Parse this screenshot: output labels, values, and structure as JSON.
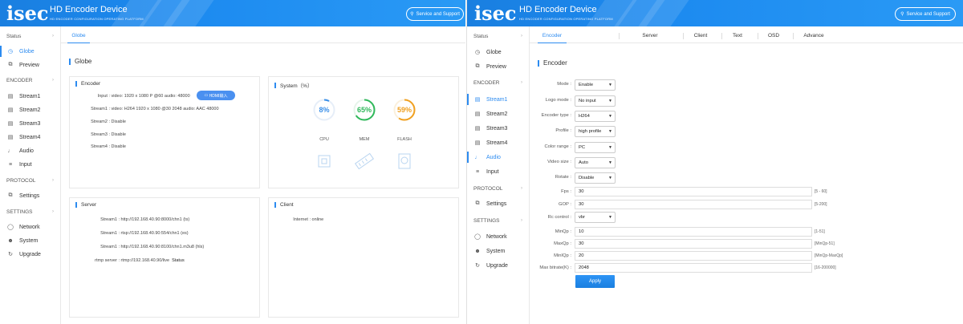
{
  "brand": {
    "logo": "isec",
    "title": "HD Encoder Device",
    "subtitle": "HD ENCODER CONFIGURATION OPERATING PLATFORM",
    "support_label": "Service and Support"
  },
  "colors": {
    "accent": "#2c8bf0",
    "header": "#1c8af0",
    "cpu": "#3a8fe8",
    "mem": "#2fb85a",
    "flash": "#f0a020"
  },
  "sidebar": {
    "status": "Status",
    "globe": "Globe",
    "preview": "Preview",
    "encoder_group": "ENCODER",
    "stream1": "Stream1",
    "stream2": "Stream2",
    "stream3": "Stream3",
    "stream4": "Stream4",
    "audio": "Audio",
    "input": "Input",
    "protocol_group": "PROTOCOL",
    "settings": "Settings",
    "settings_group": "SETTINGS",
    "network": "Network",
    "system": "System",
    "upgrade": "Upgrade"
  },
  "left": {
    "tab": "Globe",
    "section": "Globe",
    "encoder": {
      "title": "Encoder",
      "input_label": "Input :",
      "input_value": "video: 1920 x 1080 P @60 audio: 48000",
      "hdmi": "HDMI输入",
      "stream1_label": "Stream1 :",
      "stream1_value": "video: H264 1920 x 1080 @30 2048 audio: AAC 48000",
      "stream2_label": "Stream2 :",
      "stream2_value": "Disable",
      "stream3_label": "Stream3 :",
      "stream3_value": "Disable",
      "stream4_label": "Stream4 :",
      "stream4_value": "Disable"
    },
    "system": {
      "title": "System（%）",
      "cpu_value": "8%",
      "mem_value": "65%",
      "flash_value": "59%",
      "cpu_fraction": 0.08,
      "mem_fraction": 0.65,
      "flash_fraction": 0.59,
      "cpu_label": "CPU",
      "mem_label": "MEM",
      "flash_label": "FLASH"
    },
    "server": {
      "title": "Server",
      "s1_label": "Stream1 :",
      "s1_value": "http://192.168.40.90:8000/chn1 (ts)",
      "s2_label": "Stream1 :",
      "s2_value": "rtsp://192.168.40.90:554/chn1 (es)",
      "s3_label": "Stream1 :",
      "s3_value": "http://192.168.40.90:8100/chn1.m3u8 (hls)",
      "rtmp_label": "rtmp server :",
      "rtmp_value": "rtmp://192.168.40.90/live",
      "rtmp_status": "Status"
    },
    "client": {
      "title": "Client",
      "internet_label": "Internet :",
      "internet_value": "online"
    }
  },
  "right": {
    "tabs": [
      "Encoder",
      "Server",
      "Client",
      "Text",
      "OSD",
      "Advance"
    ],
    "section": "Encoder",
    "form": {
      "mode_label": "Mode :",
      "mode_value": "Enable",
      "logo_label": "Logo mode :",
      "logo_value": "No input",
      "enctype_label": "Encoder type :",
      "enctype_value": "H264",
      "profile_label": "Profile :",
      "profile_value": "high profile",
      "color_label": "Color range :",
      "color_value": "PC",
      "vsize_label": "Video size :",
      "vsize_value": "Auto",
      "rotate_label": "Rotate :",
      "rotate_value": "Disable",
      "fps_label": "Fps :",
      "fps_value": "30",
      "fps_hint": "[5 - 60]",
      "gop_label": "GOP :",
      "gop_value": "30",
      "gop_hint": "[5-200]",
      "rc_label": "Rc control :",
      "rc_value": "vbr",
      "minqp_label": "MinQp :",
      "minqp_value": "10",
      "minqp_hint": "[1-51]",
      "maxqp_label": "MaxQp :",
      "maxqp_value": "30",
      "maxqp_hint": "[MinQp-51]",
      "miniqp_label": "MinIQp :",
      "miniqp_value": "20",
      "miniqp_hint": "[MinQp-MaxQp]",
      "bitrate_label": "Max bitrate(K) :",
      "bitrate_value": "2048",
      "bitrate_hint": "[16-200000]",
      "apply_label": "Apply"
    }
  }
}
